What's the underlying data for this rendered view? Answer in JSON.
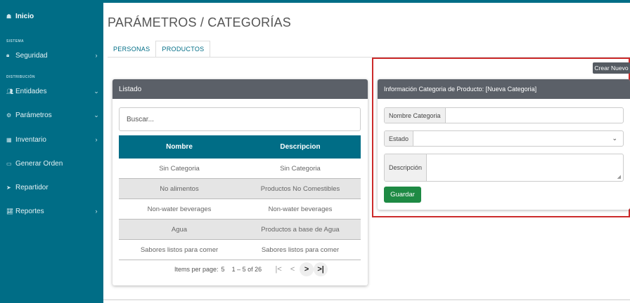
{
  "sidebar": {
    "home": {
      "label": "Inicio",
      "icon": "home-icon"
    },
    "sections": {
      "sistema": "SISTEMA",
      "distribucion": "DISTRIBUCIÓN"
    },
    "items": [
      {
        "label": "Seguridad",
        "icon": "lock-icon",
        "chevron": "›"
      },
      {
        "label": "Entidades",
        "icon": "users-icon",
        "chevron": "⌄"
      },
      {
        "label": "Parámetros",
        "icon": "gears-icon",
        "chevron": "⌄"
      },
      {
        "label": "Inventario",
        "icon": "grid-icon",
        "chevron": "›"
      },
      {
        "label": "Generar Orden",
        "icon": "cart-icon",
        "chevron": ""
      },
      {
        "label": "Repartidor",
        "icon": "send-icon",
        "chevron": ""
      },
      {
        "label": "Reportes",
        "icon": "chart-icon",
        "chevron": "›"
      }
    ],
    "color": "#006d86"
  },
  "header": {
    "title": "PARÁMETROS / CATEGORÍAS"
  },
  "tabs": [
    {
      "label": "PERSONAS",
      "active": false
    },
    {
      "label": "PRODUCTOS",
      "active": true
    }
  ],
  "listado": {
    "title": "Listado",
    "search_placeholder": "Buscar...",
    "columns": [
      "Nombre",
      "Descripcion"
    ],
    "rows": [
      [
        "Sin Categoria",
        "Sin Categoria"
      ],
      [
        "No alimentos",
        "Productos No Comestibles"
      ],
      [
        "Non-water beverages",
        "Non-water beverages"
      ],
      [
        "Agua",
        "Productos a base de Agua"
      ],
      [
        "Sabores listos para comer",
        "Sabores listos para comer"
      ]
    ],
    "paginator": {
      "items_per_page_label": "Items per page:",
      "items_per_page": "5",
      "range": "1 – 5 of 26",
      "first": "|<",
      "prev": "<",
      "next": ">",
      "last": ">|"
    }
  },
  "form": {
    "new_button": "Crear Nuevo",
    "title": "Información Categoria de Producto: [Nueva Categoria]",
    "fields": {
      "nombre_label": "Nombre Categoria",
      "nombre_value": "",
      "estado_label": "Estado",
      "estado_value": "",
      "descripcion_label": "Descripción",
      "descripcion_value": ""
    },
    "save_button": "Guardar",
    "highlight_color": "#cc2b2b",
    "save_color": "#1e8a44"
  }
}
